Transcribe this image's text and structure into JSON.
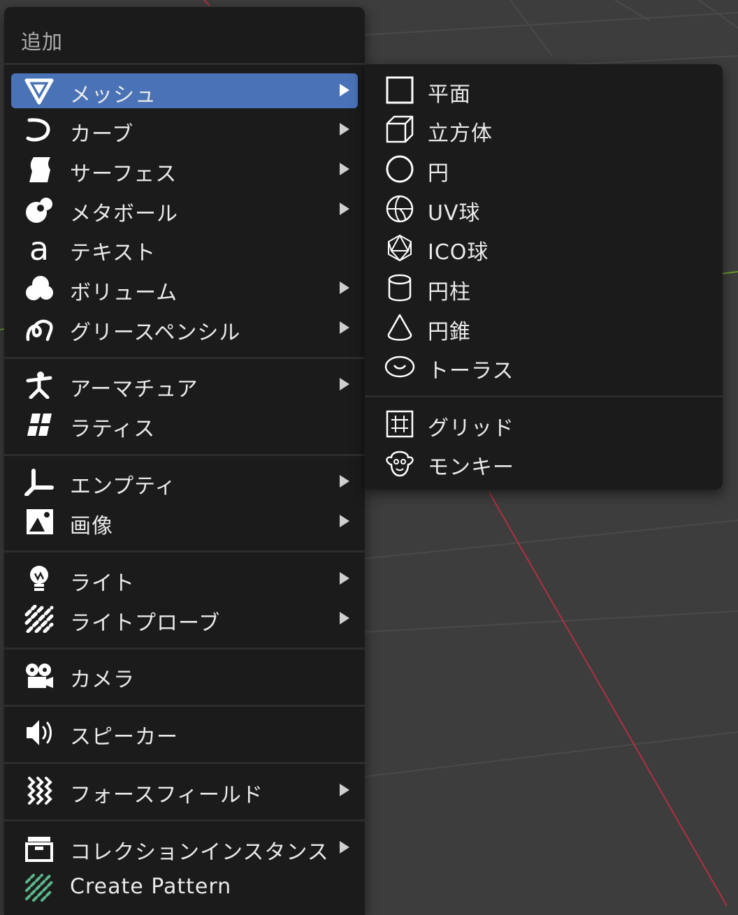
{
  "menu": {
    "title": "追加",
    "items": [
      {
        "label": "メッシュ",
        "icon": "mesh-icon",
        "submenu": true,
        "active": true
      },
      {
        "label": "カーブ",
        "icon": "curve-icon",
        "submenu": true
      },
      {
        "label": "サーフェス",
        "icon": "surface-icon",
        "submenu": true
      },
      {
        "label": "メタボール",
        "icon": "metaball-icon",
        "submenu": true
      },
      {
        "label": "テキスト",
        "icon": "text-icon",
        "submenu": false
      },
      {
        "label": "ボリューム",
        "icon": "volume-icon",
        "submenu": true
      },
      {
        "label": "グリースペンシル",
        "icon": "grease-pencil-icon",
        "submenu": true
      },
      {
        "label": "アーマチュア",
        "icon": "armature-icon",
        "submenu": true
      },
      {
        "label": "ラティス",
        "icon": "lattice-icon",
        "submenu": false
      },
      {
        "label": "エンプティ",
        "icon": "empty-icon",
        "submenu": true
      },
      {
        "label": "画像",
        "icon": "image-icon",
        "submenu": true
      },
      {
        "label": "ライト",
        "icon": "light-icon",
        "submenu": true
      },
      {
        "label": "ライトプローブ",
        "icon": "light-probe-icon",
        "submenu": true
      },
      {
        "label": "カメラ",
        "icon": "camera-icon",
        "submenu": false
      },
      {
        "label": "スピーカー",
        "icon": "speaker-icon",
        "submenu": false
      },
      {
        "label": "フォースフィールド",
        "icon": "force-field-icon",
        "submenu": true
      },
      {
        "label": "コレクションインスタンス",
        "icon": "collection-instance-icon",
        "submenu": true
      },
      {
        "label": "Create Pattern",
        "icon": "pattern-icon",
        "submenu": false
      }
    ]
  },
  "submenu": {
    "items": [
      {
        "label": "平面",
        "icon": "plane-icon"
      },
      {
        "label": "立方体",
        "icon": "cube-icon"
      },
      {
        "label": "円",
        "icon": "circle-icon"
      },
      {
        "label": "UV球",
        "icon": "uv-sphere-icon"
      },
      {
        "label": "ICO球",
        "icon": "ico-sphere-icon"
      },
      {
        "label": "円柱",
        "icon": "cylinder-icon"
      },
      {
        "label": "円錐",
        "icon": "cone-icon"
      },
      {
        "label": "トーラス",
        "icon": "torus-icon"
      },
      {
        "label": "グリッド",
        "icon": "grid-icon"
      },
      {
        "label": "モンキー",
        "icon": "monkey-icon"
      }
    ]
  },
  "colors": {
    "menu_bg": "#1b1b1b",
    "highlight": "#4a72b6",
    "viewport_bg": "#3d3d3d",
    "x_axis": "#b03040",
    "y_axis": "#6a9a2a"
  }
}
